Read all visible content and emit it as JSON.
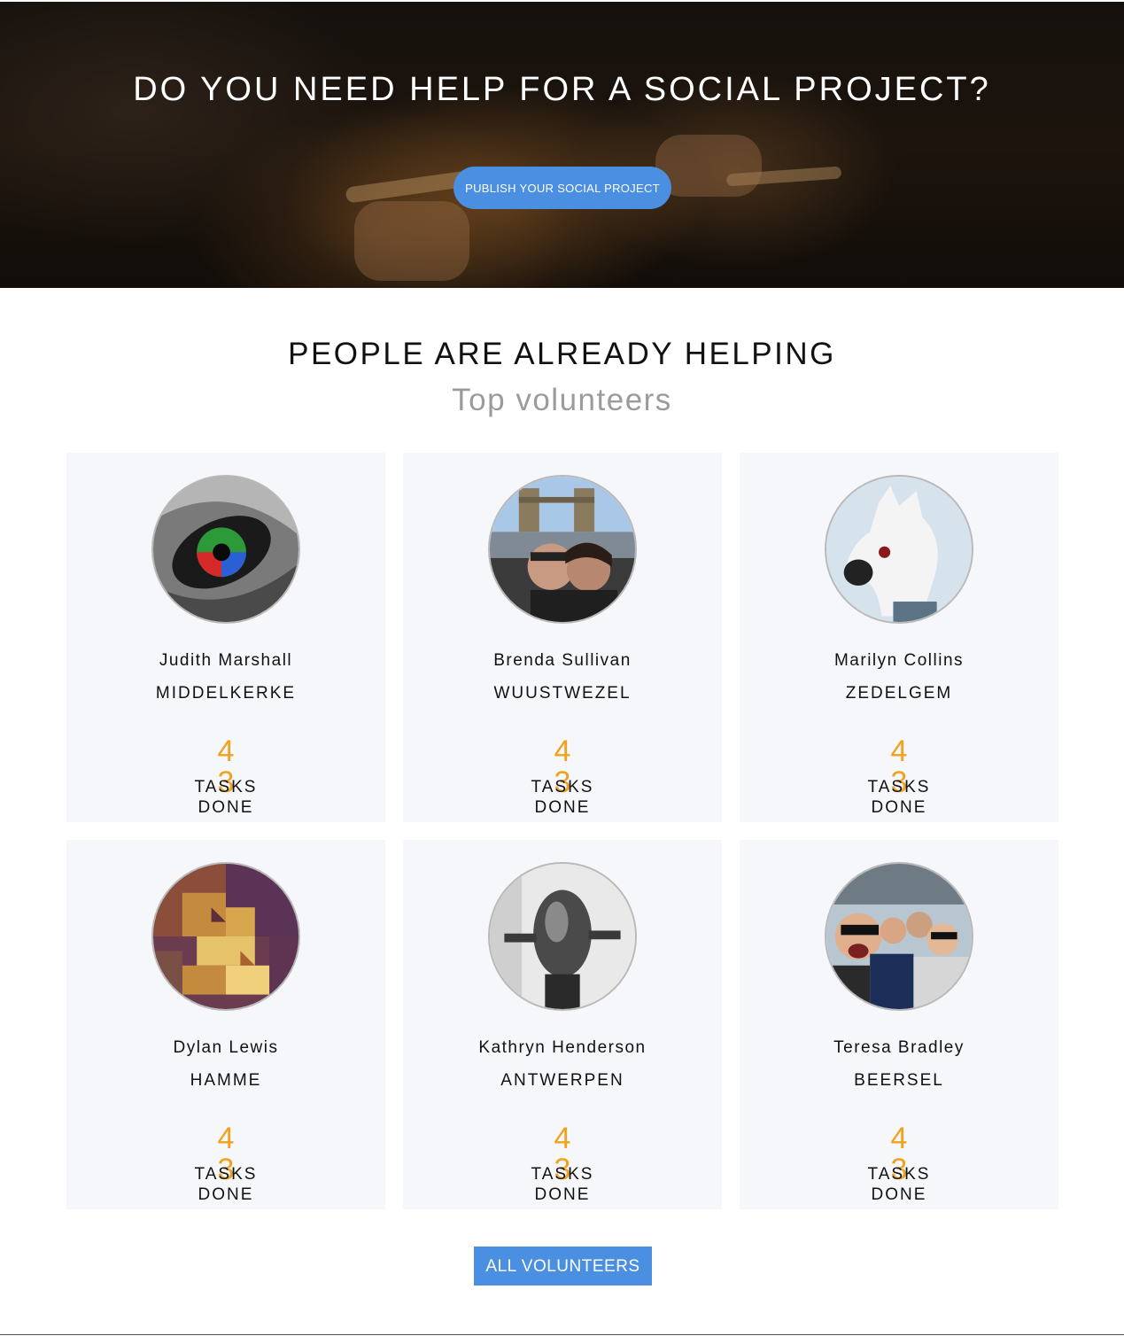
{
  "hero": {
    "title": "DO YOU NEED HELP FOR A SOCIAL PROJECT?",
    "button_label": "PUBLISH YOUR SOCIAL PROJECT"
  },
  "section": {
    "title": "PEOPLE ARE ALREADY HELPING",
    "subtitle": "Top volunteers"
  },
  "volunteers": [
    {
      "name": "Judith Marshall",
      "city": "MIDDELKERKE",
      "tasks": "4",
      "tasks_overlap": "3",
      "tasks_label": "TASKS DONE",
      "avatar": "eye-avatar"
    },
    {
      "name": "Brenda Sullivan",
      "city": "WUUSTWEZEL",
      "tasks": "4",
      "tasks_overlap": "3",
      "tasks_label": "TASKS DONE",
      "avatar": "couple-selfie-avatar"
    },
    {
      "name": "Marilyn Collins",
      "city": "ZEDELGEM",
      "tasks": "4",
      "tasks_overlap": "3",
      "tasks_label": "TASKS DONE",
      "avatar": "horse-mask-avatar"
    },
    {
      "name": "Dylan Lewis",
      "city": "HAMME",
      "tasks": "4",
      "tasks_overlap": "3",
      "tasks_label": "TASKS DONE",
      "avatar": "pixel-mosaic-avatar"
    },
    {
      "name": "Kathryn Henderson",
      "city": "ANTWERPEN",
      "tasks": "4",
      "tasks_overlap": "3",
      "tasks_label": "TASKS DONE",
      "avatar": "head-sculpture-avatar"
    },
    {
      "name": "Teresa Bradley",
      "city": "BEERSEL",
      "tasks": "4",
      "tasks_overlap": "3",
      "tasks_label": "TASKS DONE",
      "avatar": "group-selfie-avatar"
    }
  ],
  "all_button": {
    "label": "ALL VOLUNTEERS"
  },
  "colors": {
    "accent": "#4a8fe2",
    "tasks": "#f0a21e",
    "card_bg": "#f6f7fb",
    "subtitle": "#9b9b9b"
  }
}
